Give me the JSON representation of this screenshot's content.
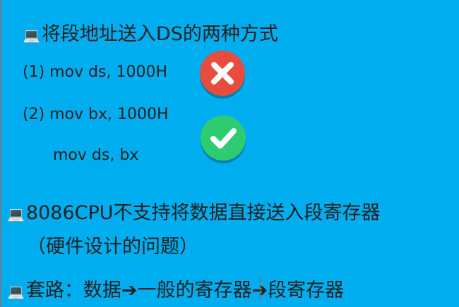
{
  "title": "将段地址送入DS的两种方式",
  "option1": "(1) mov ds, 1000H",
  "option2_line1": "(2) mov bx, 1000H",
  "option2_line2": "mov ds, bx",
  "point1_line1": "8086CPU不支持将数据直接送入段寄存器",
  "point1_line2": "（硬件设计的问题）",
  "point2": "套路：数据➔一般的寄存器➔段寄存器",
  "bullet_icon": "computer-icon",
  "colors": {
    "background": "#00adef",
    "wrong": "#e74c3c",
    "right": "#2ecc71",
    "text": "#222222"
  }
}
